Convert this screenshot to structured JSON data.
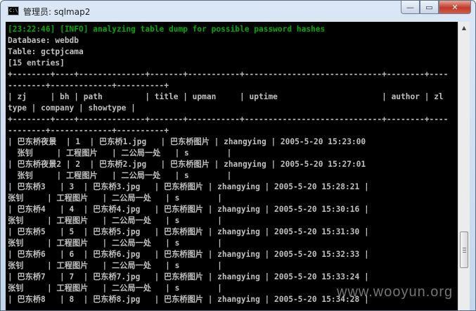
{
  "window": {
    "title": "管理员: sqlmap2",
    "icon_label": "C:\\",
    "controls": {
      "minimize": "—",
      "maximize": "▭",
      "close": "✕"
    }
  },
  "console": {
    "lines": [
      "[23:22:46] [INFO] analyzing table dump for possible password hashes",
      "Database: webdb",
      "Table: gctpjcama",
      "[15 entries]",
      "+--------+----+--------------+-------+-----------+-----------------------------+--------+----",
      "--------+-------------+----------+",
      "| zj     | bh | path         | title | upman     | uptime                      | author | zl",
      "type | company | showtype |",
      "+--------+----+--------------+-------+-----------+-----------------------------+--------+----",
      "--------+-------------+----------+",
      "| 巴东桥夜景  | 1  | 巴东桥1.jpg   | 巴东桥图片 | zhangying | 2005-5-20 15:23:00",
      "  张钊     | 工程图片   | 二公局一处   | s        |",
      "| 巴东桥夜景2 | 2  | 巴东桥2.jpg   | 巴东桥图片 | zhangying | 2005-5-20 15:27:01",
      "  张钊     | 工程图片   | 二公局一处   | s        |",
      "| 巴东桥3   | 3  | 巴东桥3.jpg   | 巴东桥图片 | zhangying | 2005-5-20 15:28:21 |",
      "张钊     | 工程图片   | 二公局一处   | s        |",
      "| 巴东桥4   | 4  | 巴东桥4.jpg   | 巴东桥图片 | zhangying | 2005-5-20 15:30:16 |",
      "张钊     | 工程图片   | 二公局一处   | s        |",
      "| 巴东桥5   | 5  | 巴东桥5.jpg   | 巴东桥图片 | zhangying | 2005-5-20 15:31:30 |",
      "张钊     | 工程图片   | 二公局一处   | s        |",
      "| 巴东桥6   | 6  | 巴东桥6.jpg   | 巴东桥图片 | zhangying | 2005-5-20 15:32:33 |",
      "张钊     | 工程图片   | 二公局一处   | s        |",
      "| 巴东桥7   | 7  | 巴东桥7.jpg   | 巴东桥图片 | zhangying | 2005-5-20 15:33:24 |",
      "张钊     | 工程图片   | 二公局一处   | s        |",
      "| 巴东桥8   | 8  | 巴东桥8.jpg   | 巴东桥图片 | zhangying | 2005-5-20 15:34:28 |"
    ],
    "colors": {
      "background": "#000000",
      "text": "#c0c0c0",
      "info": "#00a800"
    }
  },
  "scrollbar": {
    "up_arrow": "▲",
    "thumb_position_fraction": 0.82
  },
  "watermark": "www.wooyun.org"
}
